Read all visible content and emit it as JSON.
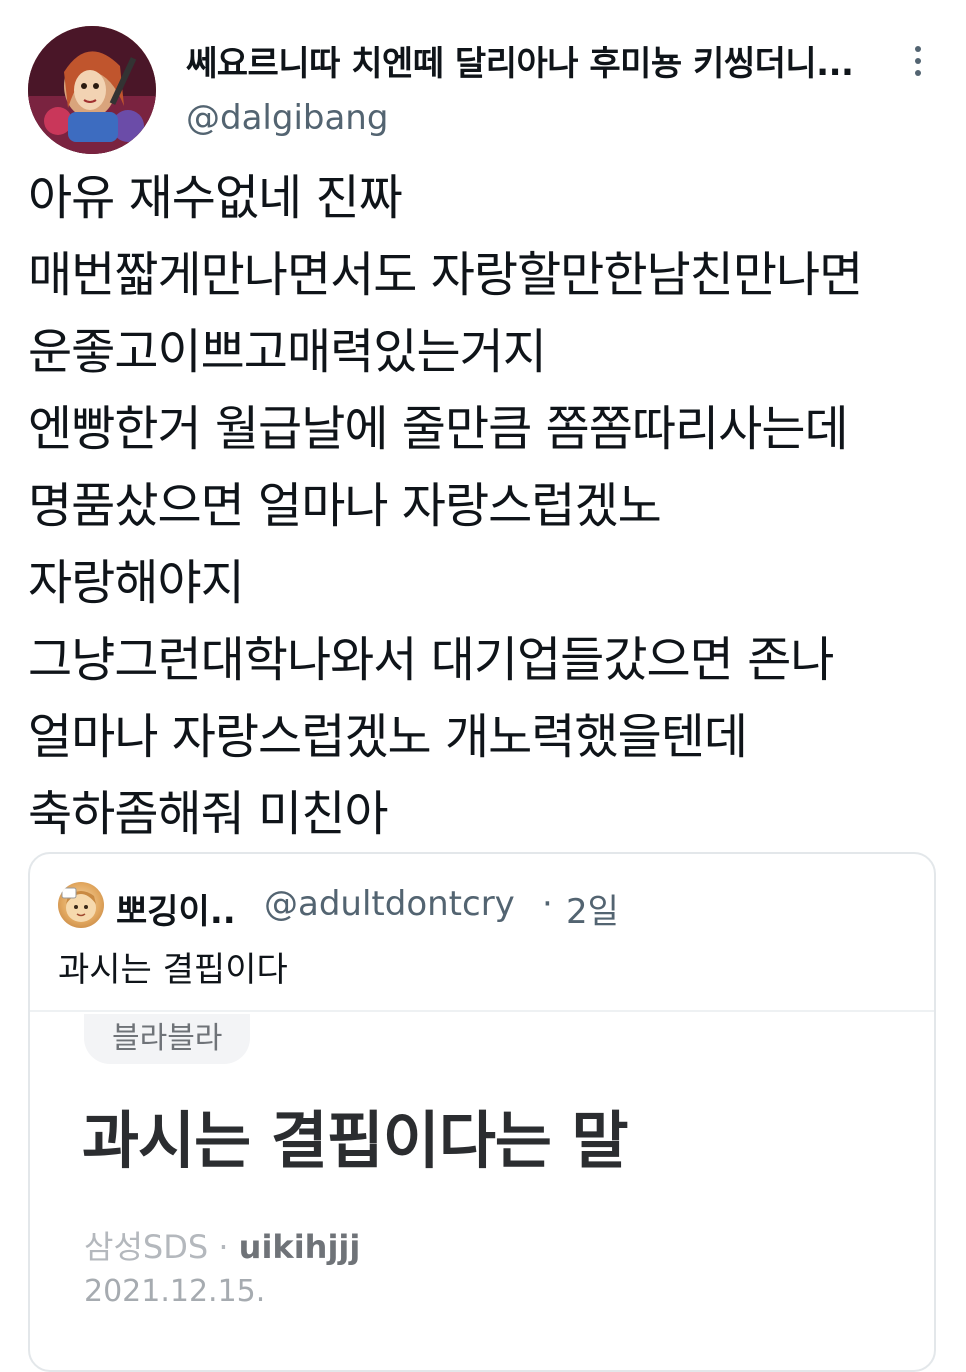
{
  "tweet": {
    "display_name": "쎄요르니따 치엔떼 달리아나 후미뇽 키씽더니...",
    "handle": "@dalgibang",
    "avatar_icon": "profile-avatar-icon",
    "more_icon": "more-options-icon",
    "body_lines": [
      "아유 재수없네 진짜",
      "매번짧게만나면서도 자랑할만한남친만나면",
      "운좋고이쁘고매력있는거지",
      "엔빵한거 월급날에 줄만큼 쫌쫌따리사는데",
      "명품샀으면 얼마나 자랑스럽겠노",
      "자랑해야지",
      "그냥그런대학나와서 대기업들갔으면 존나",
      "얼마나 자랑스럽겠노 개노력했을텐데",
      "축하좀해줘 미친아"
    ]
  },
  "quote": {
    "display_name": "뽀깅이..",
    "handle": "@adultdontcry",
    "separator": "·",
    "time": "2일",
    "text": "과시는 결핍이다",
    "inner_post": {
      "tag": "블라블라",
      "title": "과시는 결핍이다는 말",
      "company": "삼성SDS",
      "meta_separator": "·",
      "user": "uikihjjj",
      "date": "2021.12.15."
    }
  },
  "colors": {
    "text_primary": "#0f1419",
    "text_secondary": "#536471",
    "border": "#e3e7ea"
  }
}
